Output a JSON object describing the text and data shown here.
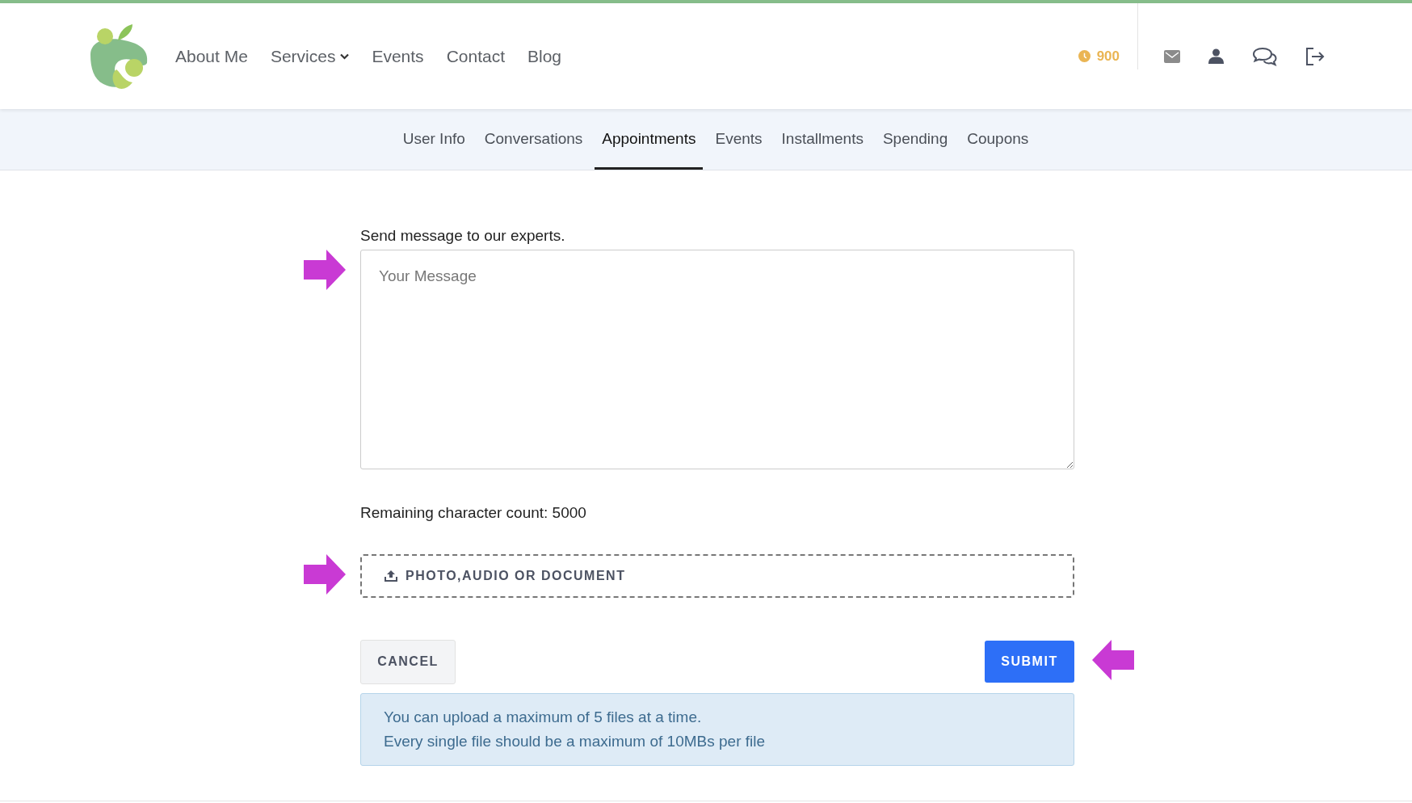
{
  "nav": [
    {
      "label": "About Me",
      "dropdown": false
    },
    {
      "label": "Services",
      "dropdown": true
    },
    {
      "label": "Events",
      "dropdown": false
    },
    {
      "label": "Contact",
      "dropdown": false
    },
    {
      "label": "Blog",
      "dropdown": false
    }
  ],
  "points": "900",
  "tabs": [
    {
      "label": "User Info",
      "selected": false
    },
    {
      "label": "Conversations",
      "selected": false
    },
    {
      "label": "Appointments",
      "selected": true
    },
    {
      "label": "Events",
      "selected": false
    },
    {
      "label": "Installments",
      "selected": false
    },
    {
      "label": "Spending",
      "selected": false
    },
    {
      "label": "Coupons",
      "selected": false
    }
  ],
  "form": {
    "label": "Send message to our experts.",
    "message": {
      "placeholder": "Your Message",
      "arrow": true
    },
    "remaining": "Remaining character count: 5000",
    "upload": {
      "label": "PHOTO,AUDIO OR DOCUMENT",
      "arrow": true
    },
    "cancel": {
      "label": "CANCEL"
    },
    "submit": {
      "label": "SUBMIT",
      "arrow": true
    },
    "info": [
      "You can upload a maximum of 5 files at a time.",
      "Every single file should be a maximum of 10MBs per file"
    ]
  }
}
